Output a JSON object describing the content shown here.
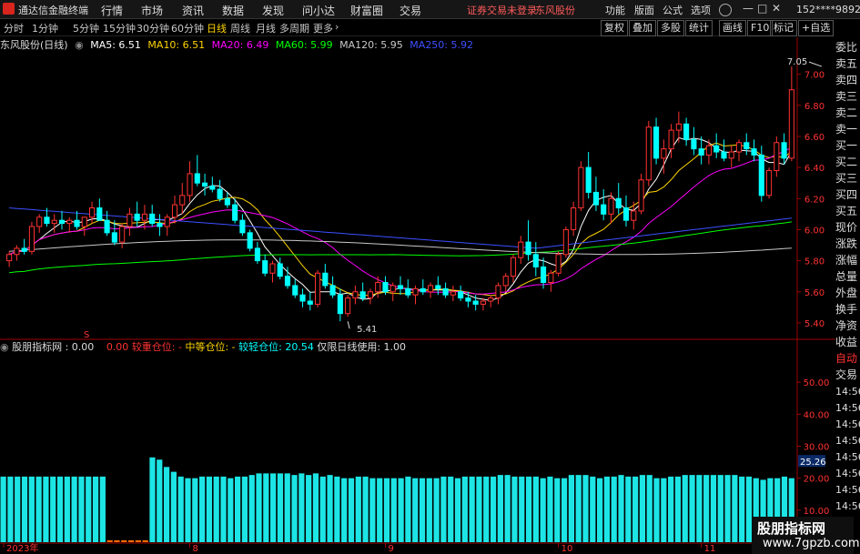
{
  "app": {
    "name": "通达信金融终端",
    "menus": [
      "行情",
      "市场",
      "资讯",
      "数据",
      "发现",
      "问小达",
      "财富圈",
      "交易"
    ],
    "notice": "证券交易未登录",
    "stock_title": "东风股份",
    "right_menus": [
      "功能",
      "版面",
      "公式",
      "选项"
    ],
    "account": "152****9892",
    "min_btn": "—",
    "max_btn": "□",
    "close_btn": "✕"
  },
  "toolbar": {
    "periods": [
      "分时",
      "1分钟",
      "5分钟",
      "15分钟",
      "30分钟",
      "60分钟",
      "日线",
      "周线",
      "月线",
      "多周期",
      "更多"
    ],
    "active": "日线",
    "right_buttons": [
      "复权",
      "叠加",
      "多股",
      "统计",
      "画线",
      "F10",
      "标记",
      "+自选"
    ],
    "back_icon": "back-arrow-icon"
  },
  "legend": {
    "stock": "东风股份(日线)",
    "ma": [
      {
        "label": "MA5: 6.51",
        "color": "#ffffff"
      },
      {
        "label": "MA10: 6.51",
        "color": "#ffd400"
      },
      {
        "label": "MA20: 6.49",
        "color": "#ff00ff"
      },
      {
        "label": "MA60: 5.99",
        "color": "#00ff00"
      },
      {
        "label": "MA120: 5.95",
        "color": "#c8c8c8"
      },
      {
        "label": "MA250: 5.92",
        "color": "#3c50ff"
      }
    ]
  },
  "right_panel": [
    "委比",
    "卖五",
    "卖四",
    "卖三",
    "卖二",
    "卖一",
    "买一",
    "买二",
    "买三",
    "买四",
    "买五",
    "现价",
    "涨跌",
    "涨幅",
    "总量",
    "外盘",
    "换手",
    "净资",
    "收益"
  ],
  "sub_panel": [
    "自动",
    "交易"
  ],
  "sub_times": [
    "14:56",
    "14:56",
    "14:56",
    "14:56",
    "14:56",
    "14:56",
    "14:56",
    "14:56"
  ],
  "sublegend": {
    "name": "股朋指标网",
    "v0": ": 0.00",
    "v1": "0.00",
    "heavy": "较重仓位: -",
    "mid": "中等仓位: -",
    "light": "较轻仓位: 20.54",
    "note": "仅限日线使用: 1.00"
  },
  "watermark": {
    "line1": "股朋指标网",
    "line2": "www.7gpzb.com"
  },
  "colors": {
    "up": "#ff3232",
    "down": "#00ffff",
    "bg": "#000000",
    "grid": "#7a0000",
    "axis": "#a00000"
  },
  "chart_data": [
    {
      "type": "candlestick",
      "title": "东风股份(日线)",
      "ylim": [
        5.3,
        7.15
      ],
      "yticks": [
        5.4,
        5.6,
        5.8,
        6.0,
        6.2,
        6.4,
        6.6,
        6.8,
        7.0
      ],
      "xlabels": [
        {
          "label": "2023年",
          "index": 0
        },
        {
          "label": "8",
          "index": 24
        },
        {
          "label": "9",
          "index": 50
        },
        {
          "label": "10",
          "index": 73
        },
        {
          "label": "11",
          "index": 92
        }
      ],
      "annotations": [
        {
          "text": "7.05",
          "index": 108,
          "value": 7.05
        },
        {
          "text": "5.41",
          "index": 45,
          "value": 5.41
        }
      ],
      "ohlc": [
        [
          5.8,
          5.86,
          5.76,
          5.84
        ],
        [
          5.84,
          5.9,
          5.8,
          5.88
        ],
        [
          5.88,
          5.94,
          5.84,
          5.86
        ],
        [
          5.86,
          6.05,
          5.84,
          6.02
        ],
        [
          6.02,
          6.1,
          5.98,
          6.08
        ],
        [
          6.08,
          6.14,
          6.02,
          6.04
        ],
        [
          6.04,
          6.1,
          5.98,
          6.06
        ],
        [
          6.06,
          6.12,
          6.0,
          6.04
        ],
        [
          6.04,
          6.08,
          5.98,
          6.06
        ],
        [
          6.06,
          6.12,
          6.0,
          6.02
        ],
        [
          6.02,
          6.08,
          5.96,
          6.08
        ],
        [
          6.08,
          6.18,
          6.04,
          6.14
        ],
        [
          6.14,
          6.2,
          6.08,
          6.06
        ],
        [
          6.06,
          6.12,
          5.96,
          5.98
        ],
        [
          5.98,
          6.06,
          5.9,
          5.92
        ],
        [
          5.92,
          6.04,
          5.88,
          6.02
        ],
        [
          6.02,
          6.14,
          5.96,
          6.1
        ],
        [
          6.1,
          6.18,
          6.02,
          6.06
        ],
        [
          6.06,
          6.16,
          6.0,
          6.1
        ],
        [
          6.1,
          6.16,
          6.02,
          6.04
        ],
        [
          6.04,
          6.1,
          5.96,
          6.02
        ],
        [
          6.02,
          6.1,
          5.96,
          6.08
        ],
        [
          6.08,
          6.22,
          6.04,
          6.16
        ],
        [
          6.16,
          6.3,
          6.1,
          6.22
        ],
        [
          6.22,
          6.44,
          6.18,
          6.36
        ],
        [
          6.36,
          6.48,
          6.28,
          6.3
        ],
        [
          6.3,
          6.36,
          6.22,
          6.28
        ],
        [
          6.28,
          6.34,
          6.24,
          6.26
        ],
        [
          6.26,
          6.32,
          6.18,
          6.2
        ],
        [
          6.2,
          6.24,
          6.14,
          6.16
        ],
        [
          6.16,
          6.2,
          6.04,
          6.06
        ],
        [
          6.06,
          6.1,
          5.96,
          5.98
        ],
        [
          5.98,
          6.0,
          5.86,
          5.88
        ],
        [
          5.88,
          5.92,
          5.78,
          5.8
        ],
        [
          5.8,
          5.84,
          5.7,
          5.72
        ],
        [
          5.72,
          5.8,
          5.66,
          5.78
        ],
        [
          5.78,
          5.82,
          5.68,
          5.7
        ],
        [
          5.7,
          5.76,
          5.62,
          5.64
        ],
        [
          5.64,
          5.68,
          5.56,
          5.58
        ],
        [
          5.58,
          5.62,
          5.5,
          5.54
        ],
        [
          5.54,
          5.6,
          5.48,
          5.52
        ],
        [
          5.52,
          5.74,
          5.5,
          5.72
        ],
        [
          5.72,
          5.78,
          5.62,
          5.64
        ],
        [
          5.64,
          5.7,
          5.56,
          5.58
        ],
        [
          5.58,
          5.62,
          5.41,
          5.46
        ],
        [
          5.46,
          5.58,
          5.44,
          5.56
        ],
        [
          5.56,
          5.64,
          5.52,
          5.6
        ],
        [
          5.6,
          5.66,
          5.54,
          5.56
        ],
        [
          5.56,
          5.62,
          5.52,
          5.6
        ],
        [
          5.6,
          5.7,
          5.56,
          5.66
        ],
        [
          5.66,
          5.7,
          5.58,
          5.6
        ],
        [
          5.6,
          5.66,
          5.54,
          5.64
        ],
        [
          5.64,
          5.7,
          5.58,
          5.62
        ],
        [
          5.62,
          5.68,
          5.56,
          5.58
        ],
        [
          5.58,
          5.64,
          5.52,
          5.62
        ],
        [
          5.62,
          5.68,
          5.58,
          5.6
        ],
        [
          5.6,
          5.66,
          5.56,
          5.64
        ],
        [
          5.64,
          5.7,
          5.58,
          5.62
        ],
        [
          5.62,
          5.66,
          5.56,
          5.58
        ],
        [
          5.58,
          5.64,
          5.54,
          5.6
        ],
        [
          5.6,
          5.64,
          5.54,
          5.56
        ],
        [
          5.56,
          5.6,
          5.5,
          5.54
        ],
        [
          5.54,
          5.58,
          5.48,
          5.52
        ],
        [
          5.52,
          5.56,
          5.48,
          5.54
        ],
        [
          5.54,
          5.58,
          5.5,
          5.56
        ],
        [
          5.56,
          5.66,
          5.52,
          5.64
        ],
        [
          5.64,
          5.72,
          5.6,
          5.7
        ],
        [
          5.7,
          5.84,
          5.66,
          5.82
        ],
        [
          5.82,
          5.96,
          5.78,
          5.92
        ],
        [
          5.92,
          6.06,
          5.8,
          5.84
        ],
        [
          5.84,
          5.92,
          5.7,
          5.76
        ],
        [
          5.76,
          5.82,
          5.62,
          5.66
        ],
        [
          5.66,
          5.74,
          5.6,
          5.72
        ],
        [
          5.72,
          5.86,
          5.7,
          5.84
        ],
        [
          5.84,
          6.02,
          5.82,
          6.0
        ],
        [
          6.0,
          6.18,
          5.96,
          6.14
        ],
        [
          6.14,
          6.44,
          6.12,
          6.4
        ],
        [
          6.4,
          6.5,
          6.2,
          6.24
        ],
        [
          6.24,
          6.34,
          6.12,
          6.16
        ],
        [
          6.16,
          6.26,
          6.06,
          6.1
        ],
        [
          6.1,
          6.24,
          6.04,
          6.2
        ],
        [
          6.2,
          6.3,
          6.1,
          6.14
        ],
        [
          6.14,
          6.22,
          6.02,
          6.06
        ],
        [
          6.06,
          6.18,
          6.0,
          6.12
        ],
        [
          6.12,
          6.36,
          6.1,
          6.32
        ],
        [
          6.32,
          6.7,
          6.28,
          6.66
        ],
        [
          6.66,
          6.72,
          6.42,
          6.46
        ],
        [
          6.46,
          6.58,
          6.36,
          6.52
        ],
        [
          6.52,
          6.68,
          6.46,
          6.64
        ],
        [
          6.64,
          6.76,
          6.56,
          6.68
        ],
        [
          6.68,
          6.72,
          6.54,
          6.58
        ],
        [
          6.58,
          6.66,
          6.48,
          6.52
        ],
        [
          6.52,
          6.6,
          6.42,
          6.48
        ],
        [
          6.48,
          6.58,
          6.42,
          6.54
        ],
        [
          6.54,
          6.62,
          6.46,
          6.5
        ],
        [
          6.5,
          6.58,
          6.44,
          6.46
        ],
        [
          6.46,
          6.54,
          6.4,
          6.5
        ],
        [
          6.5,
          6.58,
          6.44,
          6.56
        ],
        [
          6.56,
          6.62,
          6.48,
          6.52
        ],
        [
          6.52,
          6.58,
          6.44,
          6.48
        ],
        [
          6.48,
          6.54,
          6.18,
          6.22
        ],
        [
          6.22,
          6.4,
          6.2,
          6.38
        ],
        [
          6.38,
          6.6,
          6.34,
          6.56
        ],
        [
          6.56,
          6.62,
          6.42,
          6.46
        ],
        [
          6.46,
          7.05,
          6.44,
          6.9
        ]
      ],
      "series": [
        {
          "name": "MA5",
          "color": "#ffffff"
        },
        {
          "name": "MA10",
          "color": "#ffd400"
        },
        {
          "name": "MA20",
          "color": "#ff00ff"
        },
        {
          "name": "MA60",
          "color": "#00ff00"
        },
        {
          "name": "MA120",
          "color": "#c8c8c8"
        },
        {
          "name": "MA250",
          "color": "#3c50ff"
        }
      ]
    },
    {
      "type": "bar",
      "title": "股朋指标网",
      "ylim": [
        0,
        60
      ],
      "yticks": [
        10,
        20,
        30,
        40,
        50
      ],
      "marker": {
        "text": "25.26",
        "value": 25.26
      },
      "values": [
        20.5,
        20.5,
        20.5,
        20.5,
        20.5,
        20.5,
        20.5,
        20.5,
        20.5,
        20.5,
        20.5,
        20.5,
        20.5,
        20.5,
        20.5,
        0.6,
        0.6,
        0.6,
        0.6,
        0.6,
        0.6,
        26.5,
        25.8,
        23.5,
        22.0,
        20.5,
        20.0,
        20.0,
        20.5,
        20.5,
        20.5,
        20.5,
        20.0,
        20.5,
        20.5,
        21.0,
        21.5,
        21.5,
        21.5,
        21.5,
        21.5,
        21.0,
        21.5,
        21.0,
        21.5,
        20.5,
        21.0,
        20.5,
        20.0,
        20.0,
        20.5,
        20.5,
        20.0,
        20.0,
        20.0,
        20.0,
        20.0,
        20.5,
        20.0,
        20.0,
        20.0,
        20.0,
        20.5,
        20.5,
        20.0,
        20.5,
        20.5,
        20.5,
        20.5,
        20.5,
        21.0,
        21.0,
        20.5,
        20.5,
        20.5,
        20.5,
        20.0,
        20.5,
        20.0,
        20.0,
        21.0,
        21.0,
        21.0,
        20.5,
        20.0,
        20.5,
        20.5,
        21.0,
        20.5,
        20.5,
        21.0,
        21.0,
        20.0,
        20.0,
        20.5,
        20.5,
        21.0,
        21.0,
        21.0,
        21.0,
        21.0,
        21.0,
        21.0,
        21.0,
        20.5,
        20.5,
        20.0,
        19.5,
        20.0,
        20.0,
        20.5,
        20.0
      ]
    }
  ]
}
